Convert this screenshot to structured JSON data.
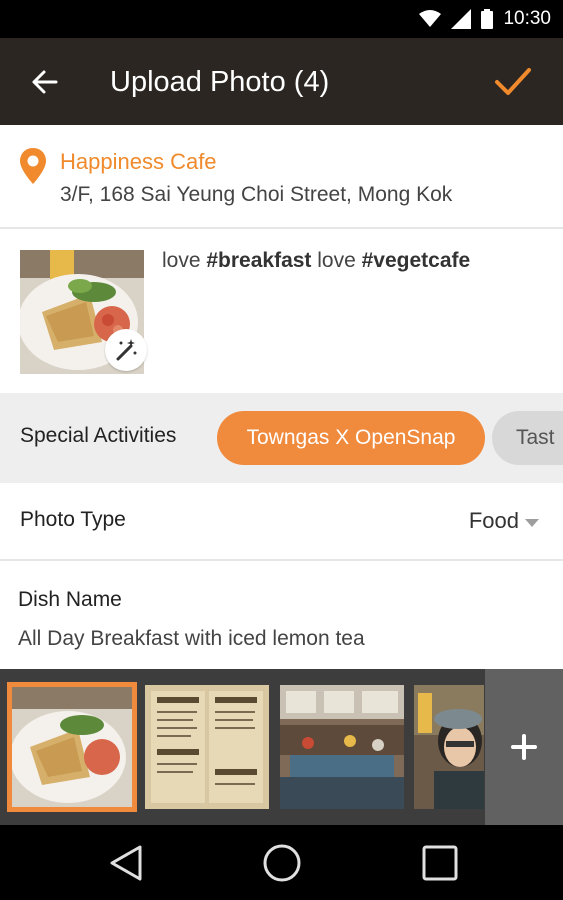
{
  "status_bar": {
    "time": "10:30"
  },
  "app_bar": {
    "title": "Upload Photo (4)"
  },
  "location": {
    "name": "Happiness Cafe",
    "address": "3/F, 168 Sai Yeung Choi Street, Mong Kok"
  },
  "post": {
    "caption_parts": [
      "love ",
      "#breakfast",
      " love ",
      "#vegetcafe"
    ]
  },
  "activities": {
    "label": "Special Activities",
    "chips": [
      "Towngas X OpenSnap",
      "Tast"
    ]
  },
  "photo_type": {
    "label": "Photo Type",
    "value": "Food"
  },
  "dish": {
    "label": "Dish Name",
    "value": "All Day Breakfast with iced lemon tea"
  },
  "colors": {
    "accent": "#f08a2c",
    "app_bar": "#2b2622",
    "filmstrip": "#3d3d3d"
  }
}
